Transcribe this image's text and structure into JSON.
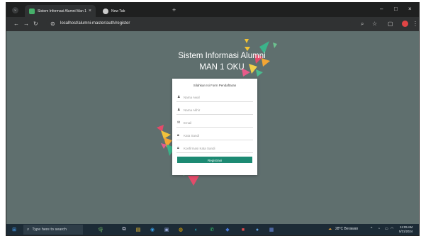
{
  "browser": {
    "tabs": [
      {
        "label": "Sistem Informasi Alumni Man 1",
        "favicon_color": "#46b06a",
        "close": "×"
      },
      {
        "label": "New Tab",
        "favicon_color": "#cccccc"
      }
    ],
    "new_tab_glyph": "+",
    "window_controls": [
      "–",
      "□",
      "×"
    ],
    "nav_icons": [
      "back-icon",
      "forward-icon",
      "reload-icon"
    ],
    "url": "localhost/alumni-master/auth/register",
    "right_icons": [
      "zoom-icon",
      "star-icon",
      "extensions-icon",
      "profile-icon",
      "menu-icon"
    ]
  },
  "page": {
    "title_line1": "Sistem Informasi Alumni",
    "title_line2": "MAN 1 OKU",
    "form": {
      "heading": "Silahkan Isi Form Pendaftaran",
      "fields": [
        {
          "icon": "user-icon",
          "placeholder": "Nama Awal"
        },
        {
          "icon": "user-icon",
          "placeholder": "Nama Akhir"
        },
        {
          "icon": "envelope-icon",
          "placeholder": "Email"
        },
        {
          "icon": "lock-icon",
          "placeholder": "Kata Sandi"
        },
        {
          "icon": "lock-icon",
          "placeholder": "Konfirmasi Kata Sandi"
        }
      ],
      "submit_label": "Registrasi",
      "submit_color": "#1d8a73"
    }
  },
  "taskbar": {
    "search_placeholder": "Type here to search",
    "weather": "28°C  Berawan",
    "time": "11:05 AM",
    "date": "5/31/2024",
    "app_icons": [
      "task-view-icon",
      "file-explorer-icon",
      "edge-icon",
      "store-icon",
      "chrome-icon",
      "app-icon",
      "whatsapp-icon",
      "app-icon",
      "app-icon",
      "app-icon",
      "app-icon"
    ]
  }
}
